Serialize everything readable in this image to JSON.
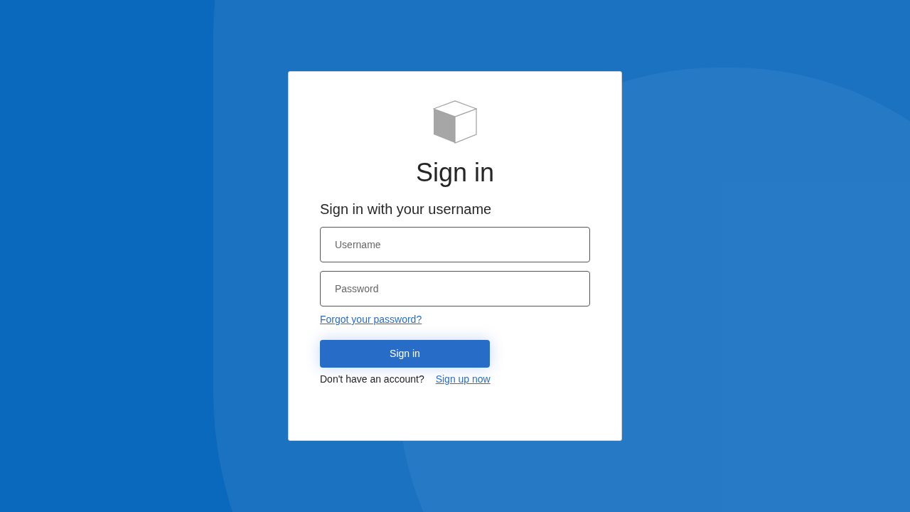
{
  "title": "Sign in",
  "subtitle": "Sign in with your username",
  "fields": [
    {
      "placeholder": "Username"
    },
    {
      "placeholder": "Password"
    }
  ],
  "forgot_link": "Forgot your password?",
  "submit_button": "Sign in",
  "signup": {
    "prompt": "Don't have an account?",
    "link": "Sign up now"
  }
}
